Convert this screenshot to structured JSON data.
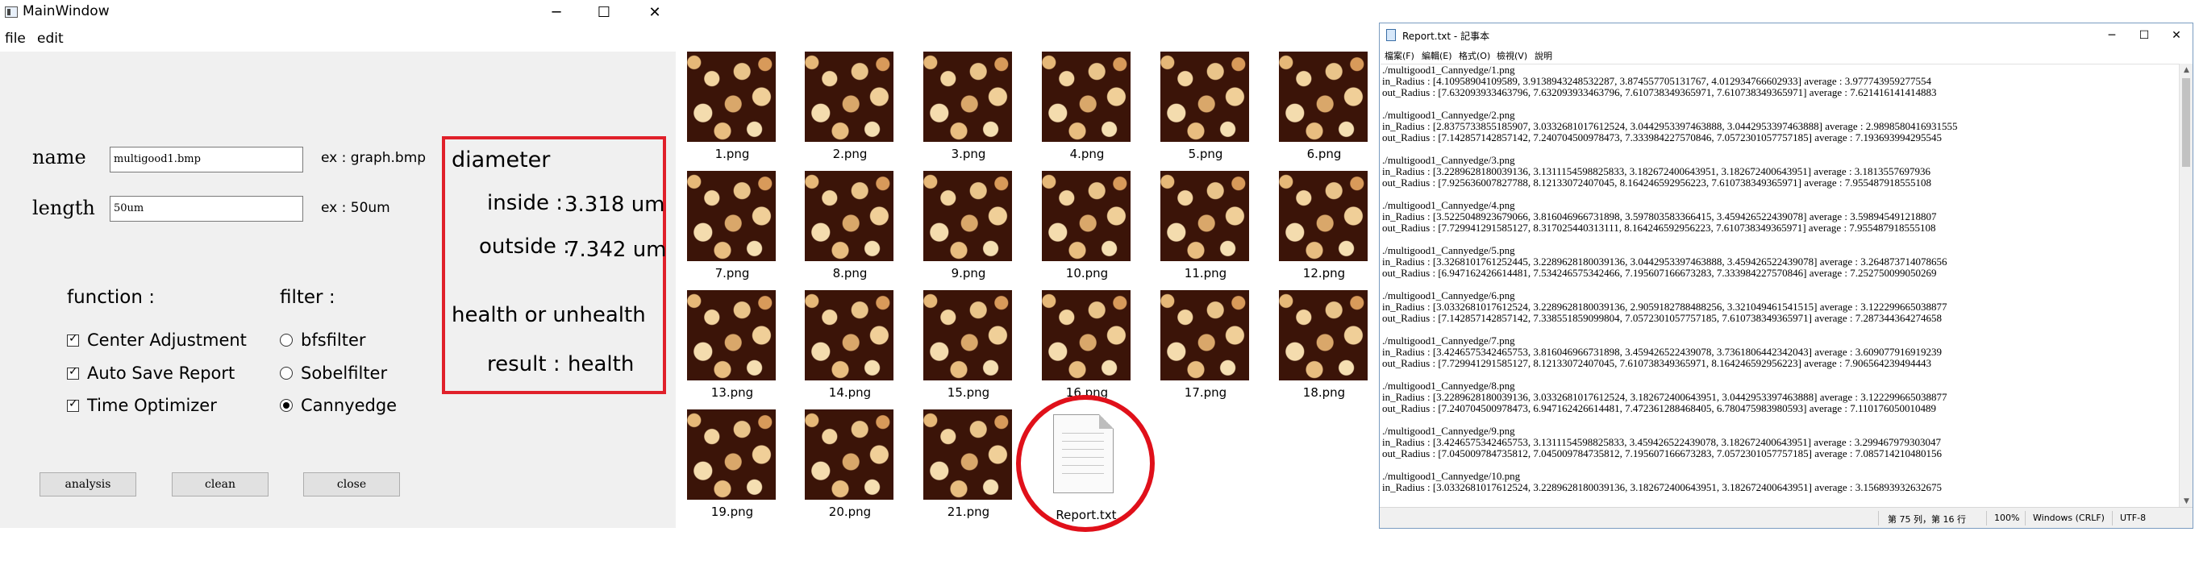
{
  "main_window": {
    "title": "MainWindow",
    "controls": {
      "minimize": "─",
      "maximize": "☐",
      "close": "✕"
    },
    "menu": [
      "file",
      "edit"
    ],
    "name_label": "name",
    "name_value": "multigood1.bmp",
    "name_hint": "ex : graph.bmp",
    "length_label": "length",
    "length_value": "50um",
    "length_hint": "ex : 50um",
    "result": {
      "diameter": "diameter",
      "inside_label": "inside :",
      "inside_value": "3.318 um",
      "outside_label": "outside :",
      "outside_value": "7.342 um",
      "health_title": "health or unhealth",
      "result_label": "result :",
      "result_value": "health",
      "border_color": "#e0202a"
    },
    "function_title": "function :",
    "functions": [
      {
        "label": "Center Adjustment",
        "checked": true
      },
      {
        "label": "Auto Save Report",
        "checked": true
      },
      {
        "label": "Time Optimizer",
        "checked": true
      }
    ],
    "filter_title": "filter :",
    "filters": [
      {
        "label": "bfsfilter",
        "selected": false
      },
      {
        "label": "Sobelfilter",
        "selected": false
      },
      {
        "label": "Cannyedge",
        "selected": true
      }
    ],
    "buttons": {
      "analysis": "analysis",
      "clean": "clean",
      "close": "close"
    }
  },
  "files": {
    "images": [
      "1.png",
      "2.png",
      "3.png",
      "4.png",
      "5.png",
      "6.png",
      "7.png",
      "8.png",
      "9.png",
      "10.png",
      "11.png",
      "12.png",
      "13.png",
      "14.png",
      "15.png",
      "16.png",
      "17.png",
      "18.png",
      "19.png",
      "20.png",
      "21.png"
    ],
    "report": "Report.txt",
    "highlight_color": "#e0101a"
  },
  "notepad": {
    "title": "Report.txt - 記事本",
    "controls": {
      "minimize": "─",
      "maximize": "☐",
      "close": "✕"
    },
    "menu": [
      "檔案(F)",
      "編輯(E)",
      "格式(O)",
      "檢視(V)",
      "說明"
    ],
    "lines": [
      "./multigood1_Cannyedge/1.png",
      "in_Radius : [4.10958904109589, 3.9138943248532287, 3.874557705131767, 4.012934766602933] average : 3.977743959277554",
      "out_Radius : [7.632093933463796, 7.632093933463796, 7.610738349365971, 7.610738349365971] average : 7.621416141414883",
      "",
      "./multigood1_Cannyedge/2.png",
      "in_Radius : [2.8375733855185907, 3.0332681017612524, 3.0442953397463888, 3.0442953397463888] average : 2.9898580416931555",
      "out_Radius : [7.142857142857142, 7.240704500978473, 7.333984227570846, 7.0572301057757185] average : 7.193693994295545",
      "",
      "./multigood1_Cannyedge/3.png",
      "in_Radius : [3.2289628180039136, 3.1311154598825833, 3.182672400643951, 3.182672400643951] average : 3.1813557697936",
      "out_Radius : [7.925636007827788, 8.12133072407045, 8.164246592956223, 7.610738349365971] average : 7.955487918555108",
      "",
      "./multigood1_Cannyedge/4.png",
      "in_Radius : [3.5225048923679066, 3.816046966731898, 3.597803583366415, 3.459426522439078] average : 3.598945491218807",
      "out_Radius : [7.729941291585127, 8.317025440313111, 8.164246592956223, 7.610738349365971] average : 7.955487918555108",
      "",
      "./multigood1_Cannyedge/5.png",
      "in_Radius : [3.3268101761252445, 3.2289628180039136, 3.0442953397463888, 3.459426522439078] average : 3.264873714078656",
      "out_Radius : [6.947162426614481, 7.534246575342466, 7.195607166673283, 7.333984227570846] average : 7.252750099050269",
      "",
      "./multigood1_Cannyedge/6.png",
      "in_Radius : [3.0332681017612524, 3.2289628180039136, 2.9059182788488256, 3.321049461541515] average : 3.122299665038877",
      "out_Radius : [7.142857142857142, 7.338551859099804, 7.0572301057757185, 7.610738349365971] average : 7.287344364274658",
      "",
      "./multigood1_Cannyedge/7.png",
      "in_Radius : [3.4246575342465753, 3.816046966731898, 3.459426522439078, 3.7361806442342043] average : 3.609077916919239",
      "out_Radius : [7.729941291585127, 8.12133072407045, 7.610738349365971, 8.164246592956223] average : 7.906564239494443",
      "",
      "./multigood1_Cannyedge/8.png",
      "in_Radius : [3.2289628180039136, 3.0332681017612524, 3.182672400643951, 3.0442953397463888] average : 3.122299665038877",
      "out_Radius : [7.240704500978473, 6.947162426614481, 7.472361288468405, 6.780475983980593] average : 7.110176050010489",
      "",
      "./multigood1_Cannyedge/9.png",
      "in_Radius : [3.4246575342465753, 3.1311154598825833, 3.459426522439078, 3.182672400643951] average : 3.299467979303047",
      "out_Radius : [7.045009784735812, 7.045009784735812, 7.195607166673283, 7.0572301057757185] average : 7.085714210480156",
      "",
      "./multigood1_Cannyedge/10.png",
      "in_Radius : [3.0332681017612524, 3.2289628180039136, 3.182672400643951, 3.182672400643951] average : 3.156893932632675"
    ],
    "status": {
      "position": "第 75 列，第 16 行",
      "zoom": "100%",
      "line_ending": "Windows (CRLF)",
      "encoding": "UTF-8"
    }
  }
}
